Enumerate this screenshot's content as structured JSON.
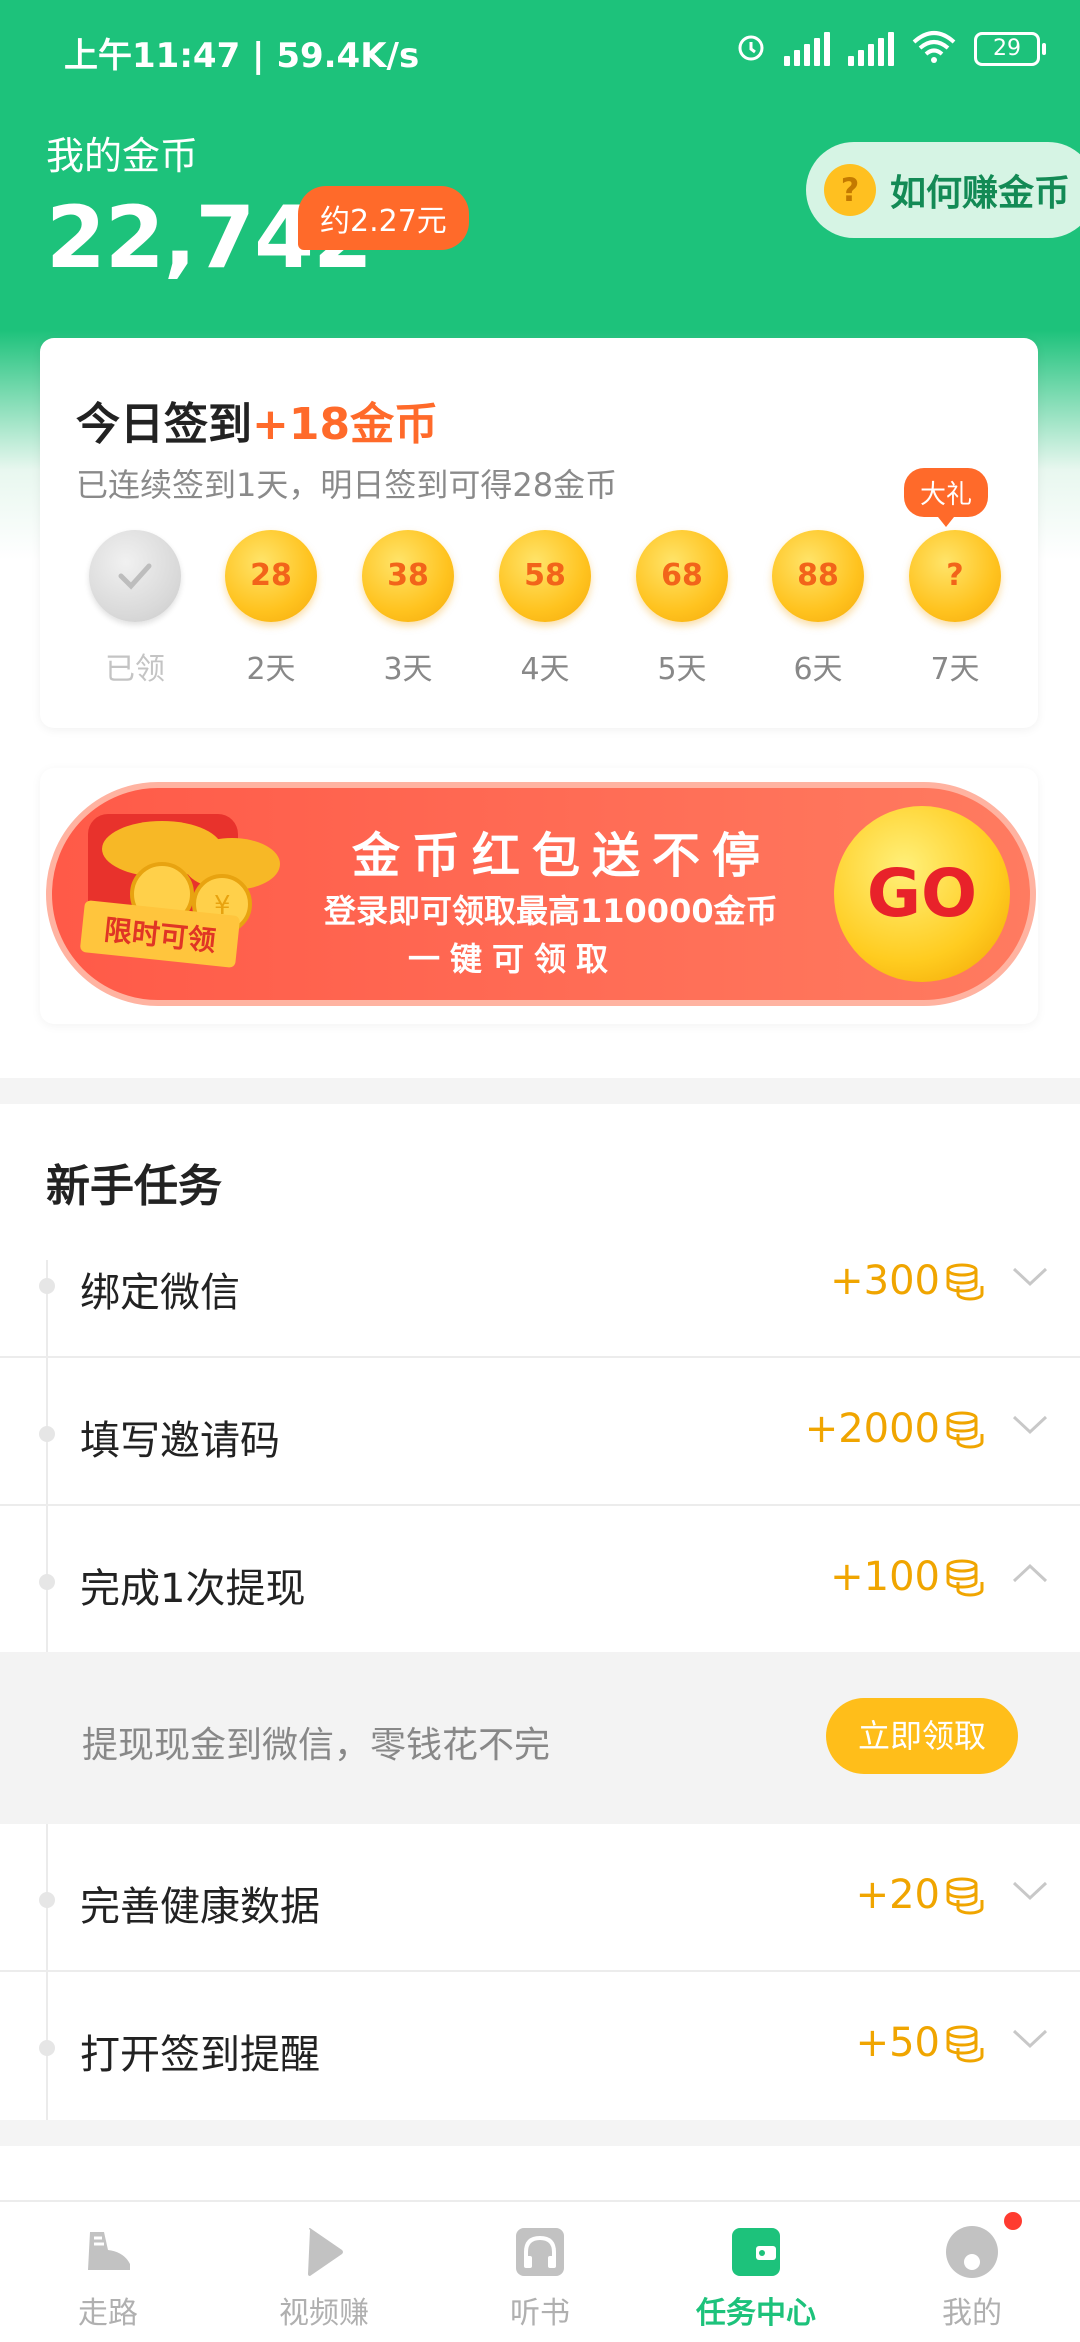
{
  "status_bar": {
    "time_speed": "上午11:47 | 59.4K/s",
    "battery": "29"
  },
  "header": {
    "coin_label": "我的金币",
    "coin_value": "22,742",
    "yuan_badge": "约2.27元",
    "how_button": "如何赚金币",
    "how_icon": "?"
  },
  "signin": {
    "title": "今日签到",
    "bonus": "+18金币",
    "subtitle": "已连续签到1天，明日签到可得28金币",
    "gift_label": "大礼",
    "days": [
      {
        "value": "",
        "label": "已领"
      },
      {
        "value": "28",
        "label": "2天"
      },
      {
        "value": "38",
        "label": "3天"
      },
      {
        "value": "58",
        "label": "4天"
      },
      {
        "value": "68",
        "label": "5天"
      },
      {
        "value": "88",
        "label": "6天"
      },
      {
        "value": "?",
        "label": "7天"
      }
    ]
  },
  "banner": {
    "title": "金币红包送不停",
    "line2": "登录即可领取最高110000金币",
    "line3": "一键可领取",
    "ribbon": "限时可领",
    "go": "GO"
  },
  "newbie": {
    "section_title": "新手任务",
    "tasks": [
      {
        "name": "绑定微信",
        "reward": "+300"
      },
      {
        "name": "填写邀请码",
        "reward": "+2000"
      },
      {
        "name": "完成1次提现",
        "reward": "+100"
      },
      {
        "name": "完善健康数据",
        "reward": "+20"
      },
      {
        "name": "打开签到提醒",
        "reward": "+50"
      }
    ],
    "expanded_desc": "提现现金到微信，零钱花不完",
    "claim_button": "立即领取"
  },
  "tabbar": {
    "items": [
      {
        "label": "走路",
        "icon": "shoe-icon"
      },
      {
        "label": "视频赚",
        "icon": "play-icon"
      },
      {
        "label": "听书",
        "icon": "headphones-icon"
      },
      {
        "label": "任务中心",
        "icon": "wallet-icon"
      },
      {
        "label": "我的",
        "icon": "profile-icon"
      }
    ],
    "active_color": "#1dc27b"
  }
}
